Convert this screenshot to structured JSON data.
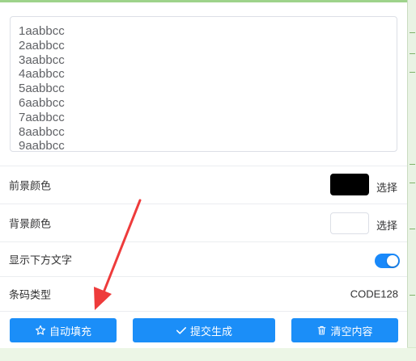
{
  "textarea": {
    "lines": [
      "1aabbcc",
      "2aabbcc",
      "3aabbcc",
      "4aabbcc",
      "5aabbcc",
      "6aabbcc",
      "7aabbcc",
      "8aabbcc",
      "9aabbcc"
    ]
  },
  "settings": {
    "foreground_label": "前景颜色",
    "foreground_color": "#000000",
    "foreground_choose": "选择",
    "background_label": "背景颜色",
    "background_color": "#ffffff",
    "background_choose": "选择",
    "show_text_label": "显示下方文字",
    "show_text_enabled": true,
    "code_type_label": "条码类型",
    "code_type_value": "CODE128"
  },
  "actions": {
    "autofill_label": "自动填充",
    "submit_label": "提交生成",
    "clear_label": "清空内容"
  },
  "colors": {
    "primary": "#1b8ef8",
    "annotation_arrow": "#ee3b3b"
  },
  "icons": {
    "autofill": "star-outline-icon",
    "submit": "check-icon",
    "clear": "trash-icon"
  }
}
